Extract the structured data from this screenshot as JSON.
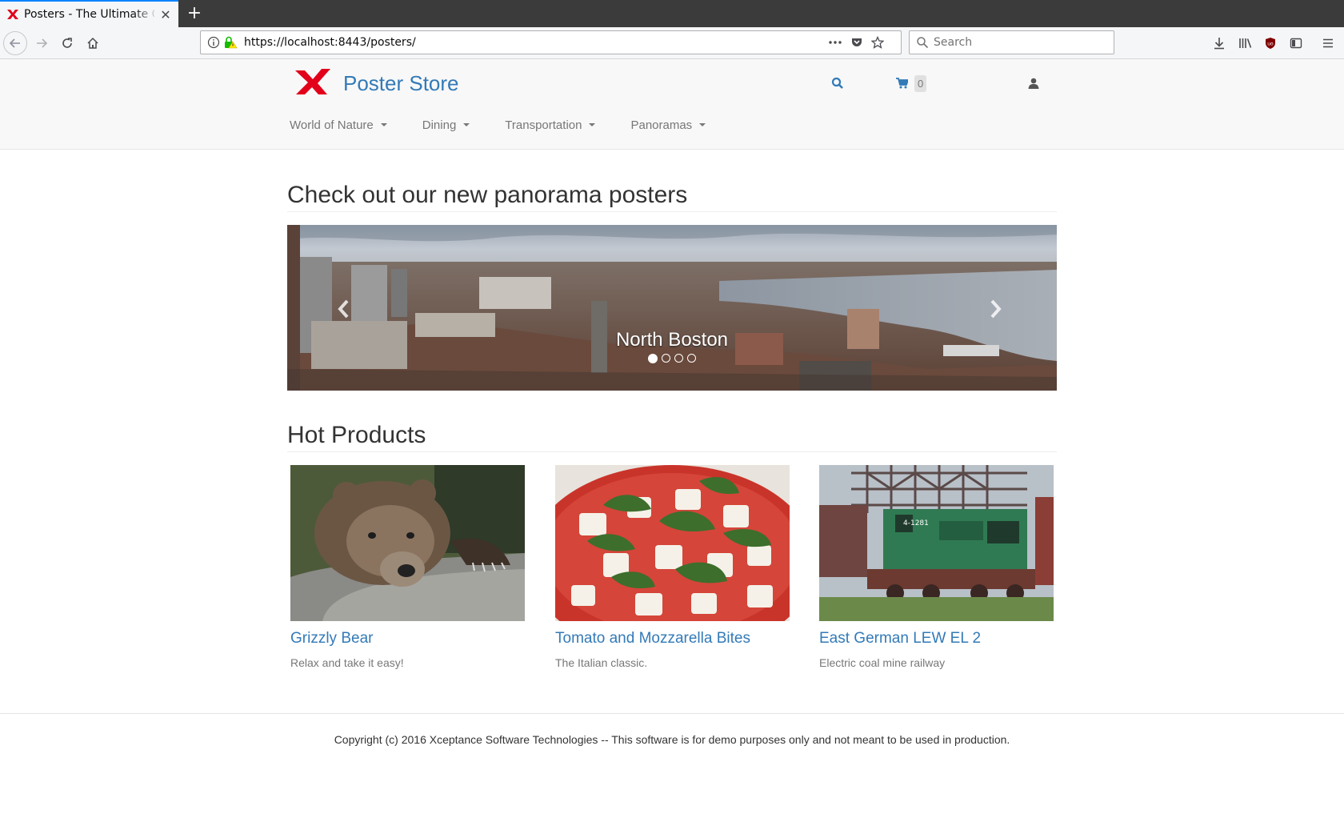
{
  "browser": {
    "tab_title": "Posters - The Ultimate Online Shop",
    "url": "https://localhost:8443/posters/",
    "search_placeholder": "Search"
  },
  "header": {
    "brand": "Poster Store",
    "cart_count": "0"
  },
  "categories": [
    {
      "label": "World of Nature"
    },
    {
      "label": "Dining"
    },
    {
      "label": "Transportation"
    },
    {
      "label": "Panoramas"
    }
  ],
  "carousel": {
    "heading": "Check out our new panorama posters",
    "caption": "North Boston",
    "slide_count": 4,
    "active_index": 0
  },
  "products": {
    "heading": "Hot Products",
    "items": [
      {
        "name": "Grizzly Bear",
        "desc": "Relax and take it easy!"
      },
      {
        "name": "Tomato and Mozzarella Bites",
        "desc": "The Italian classic."
      },
      {
        "name": "East German LEW EL 2",
        "desc": "Electric coal mine railway"
      }
    ]
  },
  "footer": {
    "text": "Copyright (c) 2016 Xceptance Software Technologies -- This software is for demo purposes only and not meant to be used in production."
  },
  "colors": {
    "link": "#337ab7",
    "brand_logo": "#e2001a",
    "header_bg": "#f8f8f8"
  }
}
